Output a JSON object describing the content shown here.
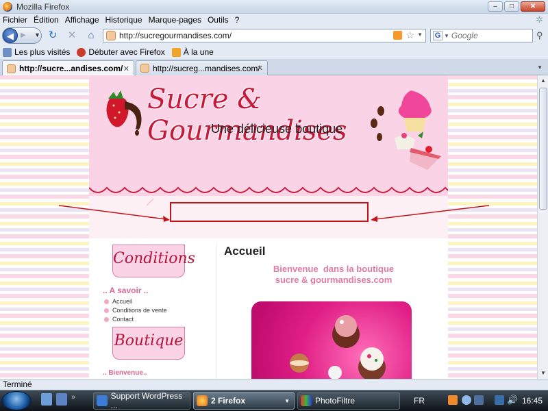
{
  "window": {
    "title": "Mozilla Firefox",
    "minimize": "‒",
    "maximize": "□",
    "close": "✕"
  },
  "menu": {
    "items": [
      {
        "label": "Fichier"
      },
      {
        "label": "Édition"
      },
      {
        "label": "Affichage"
      },
      {
        "label": "Historique"
      },
      {
        "label": "Marque-pages"
      },
      {
        "label": "Outils"
      },
      {
        "label": "?"
      }
    ]
  },
  "navigation": {
    "url": "http://sucregourmandises.com/",
    "search_placeholder": "Google",
    "search_engine_glyph": "G"
  },
  "bookmarks": [
    {
      "label": "Les plus visités",
      "icon": "star-icon"
    },
    {
      "label": "Débuter avec Firefox",
      "icon": "firefox-icon"
    },
    {
      "label": "À la une",
      "icon": "rss-icon"
    }
  ],
  "tabs": [
    {
      "label": "http://sucre...andises.com/",
      "active": true
    },
    {
      "label": "http://sucreg...mandises.com/",
      "active": false
    }
  ],
  "site": {
    "title": "Sucre & Gourmandises",
    "subtitle": "Une délicieuse boutique",
    "sidebar": {
      "badge1": "Conditions",
      "section1": ".. A savoir ..",
      "links": [
        "Accueil",
        "Conditions de vente",
        "Contact"
      ],
      "badge2": "Boutique",
      "section2": ".. Bienvenue.."
    },
    "main": {
      "heading": "Accueil",
      "welcome_line1": "Bienvenue  dans la boutique",
      "welcome_line2": "sucre & gourmandises.com"
    }
  },
  "status": {
    "text": "Terminé"
  },
  "taskbar": {
    "tasks": [
      {
        "label": "Support WordPress ...",
        "active": false
      },
      {
        "label": "2 Firefox",
        "active": true
      },
      {
        "label": "PhotoFiltre",
        "active": false
      }
    ],
    "language": "FR",
    "clock": "16:45"
  },
  "colors": {
    "accent_red": "#c61a3a",
    "pink": "#fbd3e6",
    "welcome_pink": "#e07aa2"
  }
}
